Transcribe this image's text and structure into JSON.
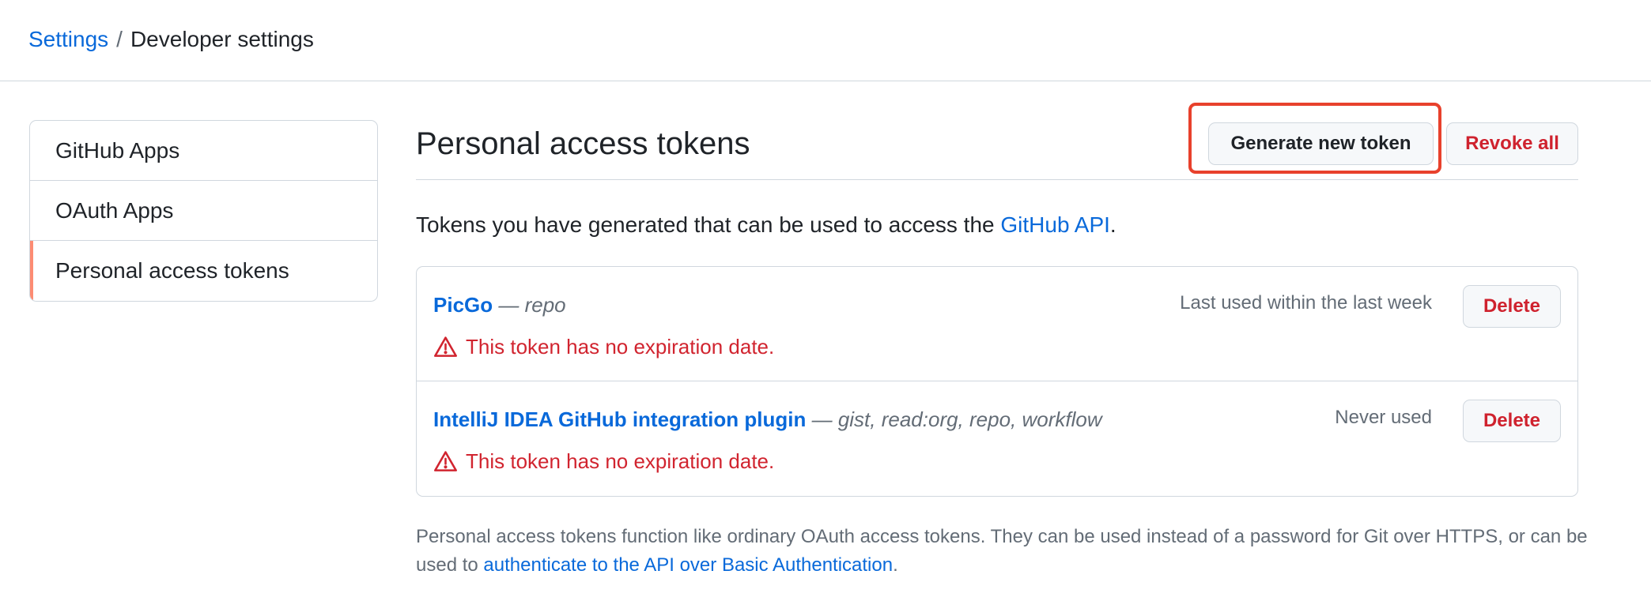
{
  "breadcrumb": {
    "root": "Settings",
    "separator": "/",
    "current": "Developer settings"
  },
  "sidebar": {
    "items": [
      {
        "label": "GitHub Apps"
      },
      {
        "label": "OAuth Apps"
      },
      {
        "label": "Personal access tokens",
        "active": true
      }
    ]
  },
  "page": {
    "title": "Personal access tokens",
    "generate_button": "Generate new token",
    "revoke_button": "Revoke all",
    "intro_prefix": "Tokens you have generated that can be used to access the ",
    "intro_link": "GitHub API",
    "intro_suffix": "."
  },
  "tokens": [
    {
      "name": "PicGo",
      "dash": " — ",
      "scopes": "repo",
      "warning": "This token has no expiration date.",
      "last_used": "Last used within the last week",
      "delete_label": "Delete"
    },
    {
      "name": "IntelliJ IDEA GitHub integration plugin",
      "dash": " — ",
      "scopes": "gist, read:org, repo, workflow",
      "warning": "This token has no expiration date.",
      "last_used": "Never used",
      "delete_label": "Delete"
    }
  ],
  "footer": {
    "text_before": "Personal access tokens function like ordinary OAuth access tokens. They can be used instead of a password for Git over HTTPS, or can be used to ",
    "link": "authenticate to the API over Basic Authentication",
    "text_after": "."
  },
  "icons": {
    "warning": "alert-triangle-icon"
  },
  "colors": {
    "link": "#0969da",
    "danger": "#cf222e",
    "warning_text": "#d1242f",
    "highlight": "#e8412c",
    "active_indicator": "#fd8c73",
    "border": "#d0d7de"
  }
}
